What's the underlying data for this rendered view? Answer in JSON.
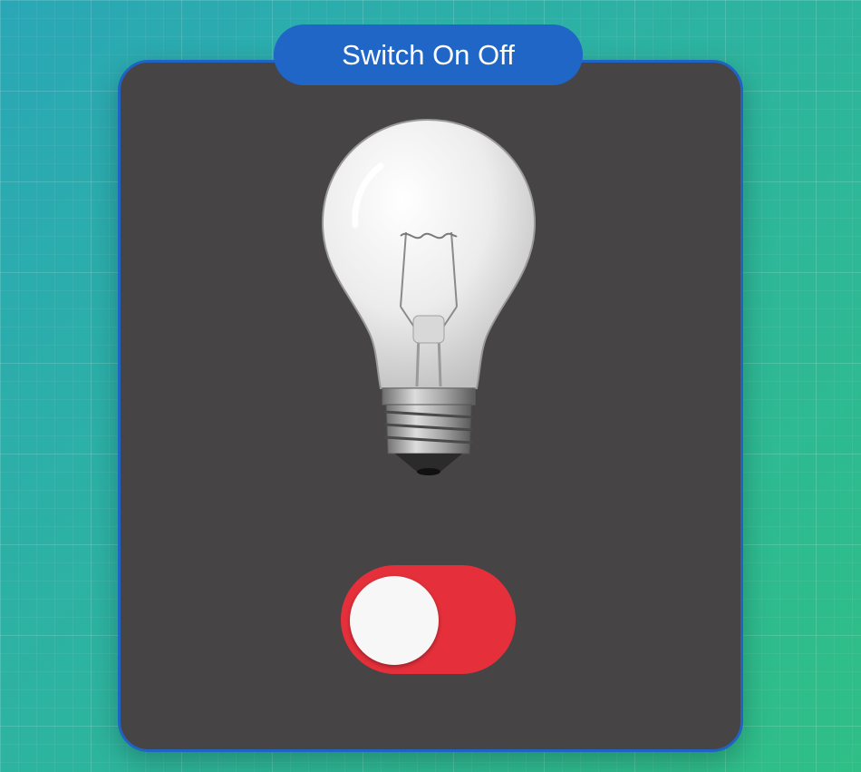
{
  "header": {
    "title": "Switch On Off"
  },
  "bulb": {
    "state": "off",
    "icon": "lightbulb-icon"
  },
  "toggle": {
    "checked": false,
    "track_color": "#e5303b",
    "knob_color": "#f7f7f7"
  },
  "colors": {
    "card_background": "#464445",
    "accent_blue": "#1f66c6"
  }
}
